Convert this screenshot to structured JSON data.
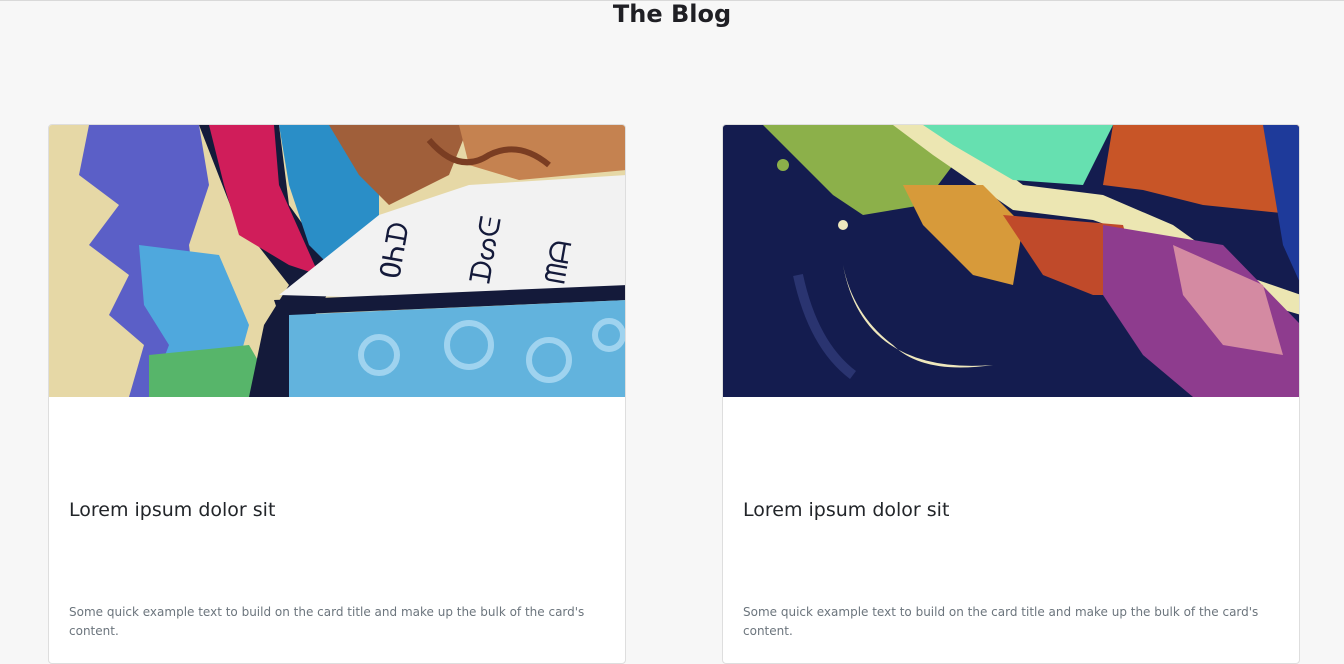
{
  "page": {
    "title": "The Blog"
  },
  "cards": [
    {
      "image_name": "colorful-graffiti-illustration",
      "title": "Lorem ipsum dolor sit",
      "text": "Some quick example text to build on the card title and make up the bulk of the card's content."
    },
    {
      "image_name": "colorful-abstract-splash-illustration",
      "title": "Lorem ipsum dolor sit",
      "text": "Some quick example text to build on the card title and make up the bulk of the card's content."
    }
  ],
  "colors": {
    "background": "#f7f7f7",
    "card": "#ffffff",
    "title": "#1f1f24",
    "muted_text": "#6c757d"
  }
}
